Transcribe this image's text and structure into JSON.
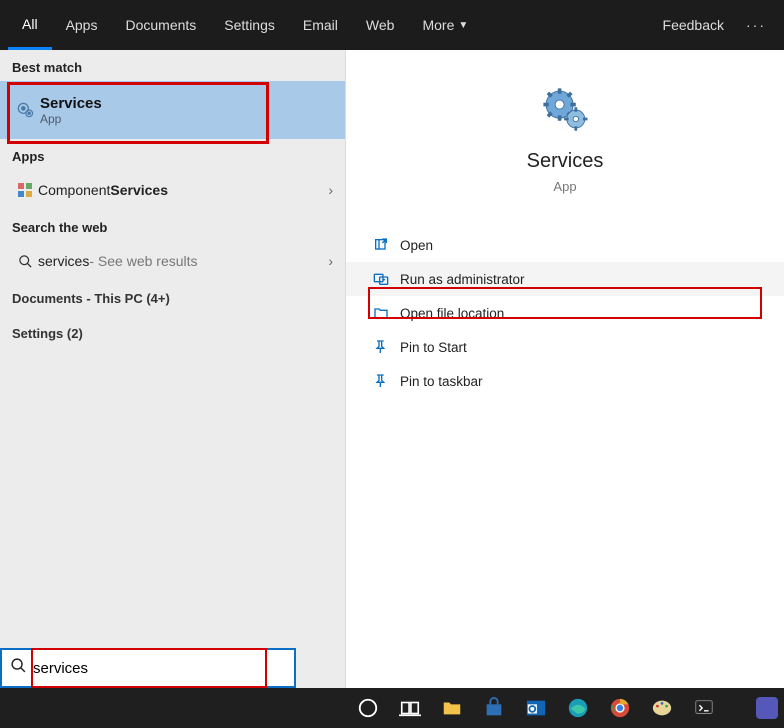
{
  "tabs": {
    "items": [
      "All",
      "Apps",
      "Documents",
      "Settings",
      "Email",
      "Web",
      "More"
    ],
    "active_index": 0,
    "feedback": "Feedback"
  },
  "left": {
    "best_match_label": "Best match",
    "services": {
      "title": "Services",
      "subtitle": "App"
    },
    "apps_label": "Apps",
    "component_services": {
      "prefix": "Component ",
      "bold": "Services"
    },
    "search_web_label": "Search the web",
    "web_result": {
      "query": "services",
      "suffix": " - See web results"
    },
    "documents_label": "Documents - This PC (4+)",
    "settings_label": "Settings (2)"
  },
  "detail": {
    "title": "Services",
    "subtitle": "App",
    "actions": [
      {
        "icon": "open",
        "label": "Open"
      },
      {
        "icon": "admin",
        "label": "Run as administrator"
      },
      {
        "icon": "folder",
        "label": "Open file location"
      },
      {
        "icon": "pin",
        "label": "Pin to Start"
      },
      {
        "icon": "pin",
        "label": "Pin to taskbar"
      }
    ]
  },
  "search": {
    "value": "services"
  },
  "taskbar": {
    "items": [
      "cortana",
      "taskview",
      "explorer",
      "store",
      "outlook",
      "edge",
      "chrome",
      "paint",
      "terminal"
    ]
  }
}
